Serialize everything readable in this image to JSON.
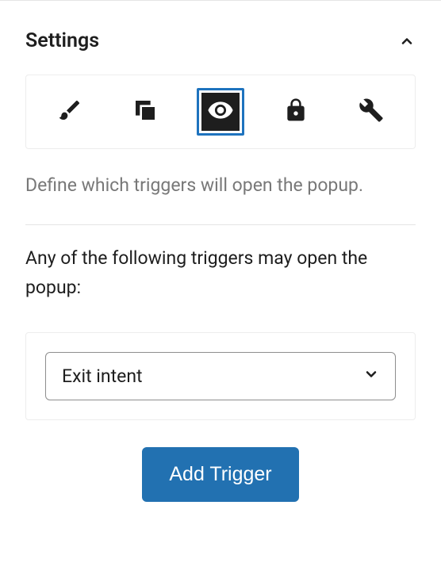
{
  "panel": {
    "title": "Settings"
  },
  "tabs": {
    "items": [
      {
        "name": "brush"
      },
      {
        "name": "layers"
      },
      {
        "name": "eye",
        "selected": true
      },
      {
        "name": "lock"
      },
      {
        "name": "wrench"
      }
    ]
  },
  "description": "Define which triggers will open the popup.",
  "instruction": "Any of the following triggers may open the popup:",
  "trigger": {
    "selected": "Exit intent"
  },
  "actions": {
    "add_label": "Add Trigger"
  },
  "colors": {
    "accent": "#2271b1"
  }
}
